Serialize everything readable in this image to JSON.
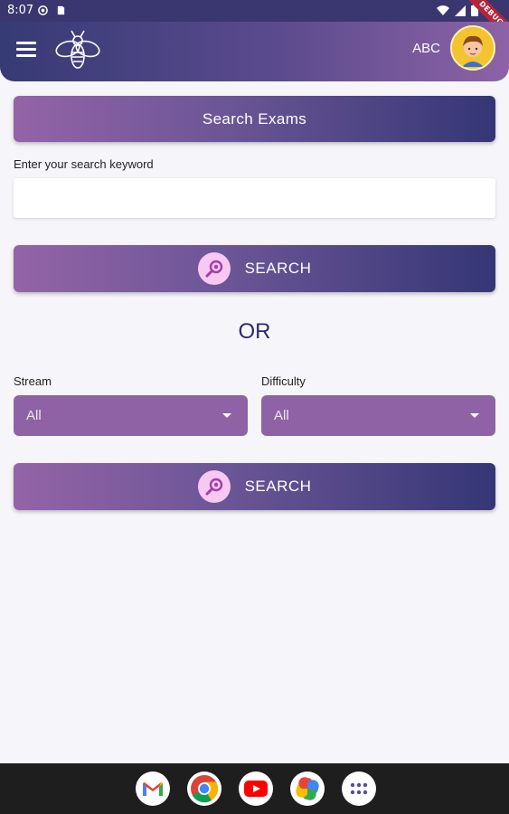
{
  "status_bar": {
    "time": "8:07",
    "debug_label": "DEBUG"
  },
  "app_bar": {
    "user_name": "ABC"
  },
  "page": {
    "title_button": "Search Exams",
    "keyword_label": "Enter your search keyword",
    "keyword_value": "",
    "keyword_placeholder": "",
    "search_label": "SEARCH",
    "or_text": "OR",
    "stream_label": "Stream",
    "stream_value": "All",
    "difficulty_label": "Difficulty",
    "difficulty_value": "All"
  },
  "dock": {
    "apps": [
      "gmail-icon",
      "chrome-icon",
      "youtube-icon",
      "photos-icon",
      "app-drawer-icon"
    ]
  },
  "colors": {
    "primary_dark": "#353675",
    "primary_light": "#9464a7",
    "dropdown": "#8e62a5",
    "or_text": "#2e2b66"
  }
}
